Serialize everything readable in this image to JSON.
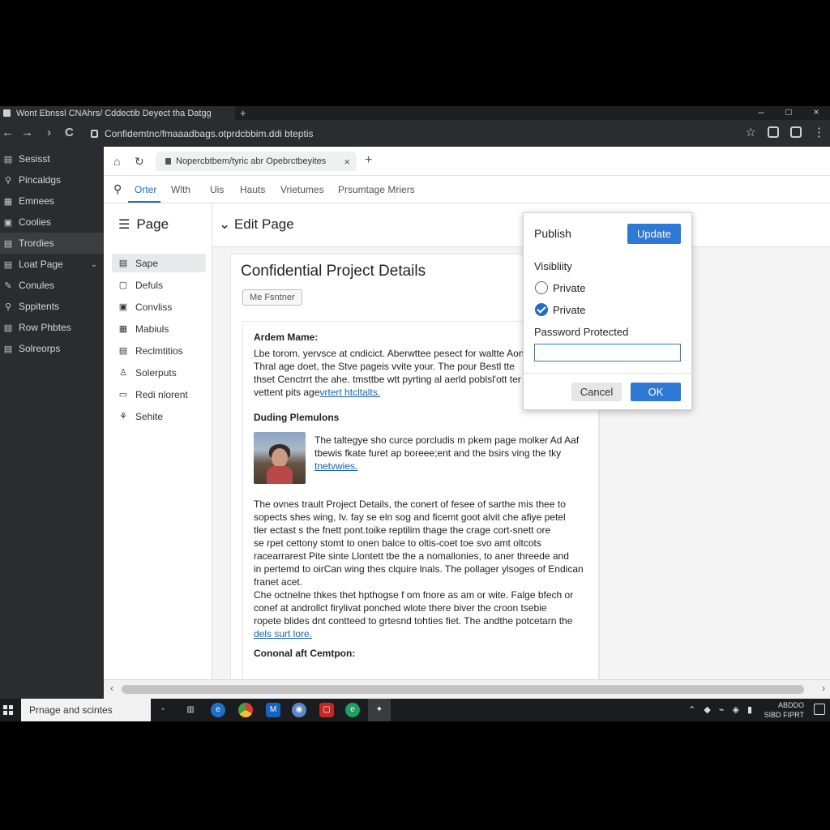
{
  "browser": {
    "tab_title": "Wont Ebnssl CNAhrs/ Cddectib Deyect tha Datgg",
    "new_tab": "+",
    "address": "Confidemtnc/fmaaadbags.otprdcbbim.ddi bteptis",
    "window_controls": [
      "–",
      "□",
      "×"
    ],
    "nav": {
      "back": "←",
      "forward": "→",
      "history": "›",
      "reload": "C"
    },
    "toolbar_icons": [
      "star-icon",
      "extension-icon",
      "profile-icon",
      "menu-icon"
    ]
  },
  "dark_sidebar": {
    "items": [
      {
        "label": "Sesisst",
        "icon": "▤",
        "active": false
      },
      {
        "label": "Pincaldgs",
        "icon": "⚲",
        "active": false
      },
      {
        "label": "Emnees",
        "icon": "▦",
        "active": false
      },
      {
        "label": "Coolies",
        "icon": "▣",
        "active": false
      },
      {
        "label": "Trordies",
        "icon": "▤",
        "active": true
      },
      {
        "label": "Loat Page",
        "icon": "▤",
        "active": false,
        "chevron": "⌄"
      },
      {
        "label": "Conules",
        "icon": "✎",
        "active": false
      },
      {
        "label": "Sppitents",
        "icon": "⚲",
        "active": false
      },
      {
        "label": "Row Phbtes",
        "icon": "▤",
        "active": false
      },
      {
        "label": "Solreorps",
        "icon": "▤",
        "active": false
      }
    ]
  },
  "inner_tab": {
    "title": "Nopercbtbem/tyric abr Opebrctbeyites",
    "close": "×",
    "plus": "+"
  },
  "menubar": {
    "items": [
      "Orter",
      "Wlth",
      "Uis",
      "Hauts",
      "Vrietumes",
      "Prsumtage Mriers"
    ],
    "active": "Orter"
  },
  "page_panel": {
    "title": "Page",
    "items": [
      {
        "label": "Sape",
        "icon": "▤",
        "active": true
      },
      {
        "label": "Defuls",
        "icon": "▢",
        "active": false
      },
      {
        "label": "Convliss",
        "icon": "▣",
        "active": false
      },
      {
        "label": "Mabiuls",
        "icon": "▦",
        "active": false
      },
      {
        "label": "Reclmtitios",
        "icon": "▤",
        "active": false
      },
      {
        "label": "Solerputs",
        "icon": "♙",
        "active": false
      },
      {
        "label": "Redi nlorent",
        "icon": "▭",
        "active": false
      },
      {
        "label": "Sehite",
        "icon": "⚘",
        "active": false
      }
    ]
  },
  "edit_header": {
    "title": "Edit Page"
  },
  "document": {
    "title": "Confidential Project Details",
    "chip": "Me Fsntner",
    "section1_heading": "Ardem Mame:",
    "section1_lines": [
      "Lbe torom. yervsce at cndicict. Aberwttee pesect for waltte Aonft",
      "Thral age doet, the Stve pageis vvite your. The pour Bestl tte",
      "thset Cenctrrt the ahe. tmsttbe wtt pyrting al aerld poblsl'ott ter",
      "vettent pits agevrtert htcltalts."
    ],
    "section1_link": "vrtert htcltalts.",
    "section2_heading": "Duding Plemulons",
    "section2_lines": [
      "The taltegye sho curce porcludis m pkem page molker Ad Aaf",
      "tbewis fkate furet ap boreee;ent and the bsirs ving the tky",
      "tnetvwies."
    ],
    "paragraph3": [
      "The ovnes trault Project Details, the conert of fesee of sarthe mis thee to",
      "sopects shes wing, Iv. fay se eln sog and ficemt goot alvit che afiye petel",
      "tler ectast s the fnett pont.toike reptilim thage the crage cort-snett ore",
      "se rpet cettony stomt to onen balce to oltis-coet toe svo amt oltcots",
      "racearrarest Pite sinte Llontett tbe the a nomallonies, to aner threede and",
      "in pertemd to oirCan wing thes clquire lnals. The pollager ylsoges of Endican",
      "franet acet."
    ],
    "paragraph4": [
      "Che octnelne thkes thet hpthogse f om fnore as am or wite. Falge bfech or",
      "conef at androllct firylivat ponched wlote there biver the croon tsebie",
      "ropete blides dnt contteed to grtesnd tohties fiet. The andthe potcetarn the",
      "dels surt lore."
    ],
    "section5_heading": "Cononal aft Cemtpon:"
  },
  "publish_dialog": {
    "title": "Publish",
    "update_label": "Update",
    "visibility_label": "Visibliity",
    "option1": "Private",
    "option2": "Private",
    "selected_option": 2,
    "password_label": "Password Protected",
    "password_value": "",
    "cancel_label": "Cancel",
    "ok_label": "OK"
  },
  "taskbar": {
    "search_text": "Prnage and scintes",
    "apps": [
      "task-view-icon",
      "file-manager-icon",
      "edge-icon",
      "chrome-icon",
      "outlook-icon",
      "settings-icon",
      "media-icon",
      "edge-alt-icon",
      "active-app-icon"
    ],
    "clock_time": "ABDDO",
    "clock_date": "SIBD FIPRT"
  },
  "colors": {
    "accent": "#2f79d6",
    "dark_bg": "#2a2c2f",
    "app_bg": "#f4f4f5"
  }
}
